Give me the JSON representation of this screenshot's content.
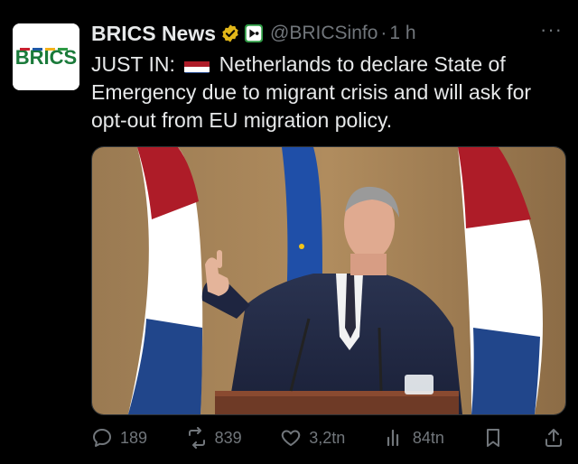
{
  "tweet": {
    "author_name": "BRICS News",
    "handle": "@BRICSinfo",
    "dot": "·",
    "time": "1 h",
    "more": "···",
    "text_prefix": "JUST IN:",
    "flag_icon": "netherlands-flag-emoji",
    "text_body": "Netherlands to declare State of Emergency due to migrant crisis and will ask for opt-out from EU migration policy.",
    "avatar_text": "BRICS"
  },
  "actions": {
    "replies": "189",
    "reposts": "839",
    "likes": "3,2tn",
    "views": "84tn"
  },
  "colors": {
    "background": "#000000",
    "text": "#e7e9ea",
    "muted": "#71767b",
    "verified": "#e2b719"
  }
}
